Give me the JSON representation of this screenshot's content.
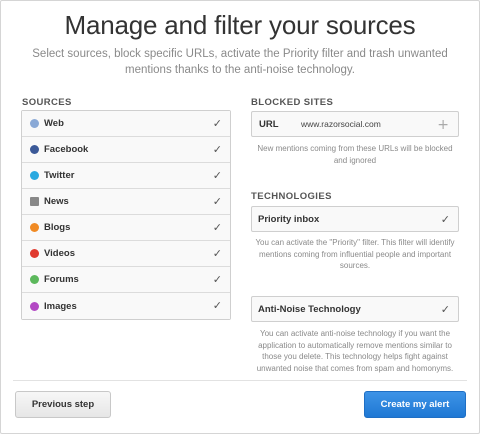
{
  "header": {
    "title": "Manage and filter your sources",
    "subtitle": "Select sources, block specific URLs, activate the Priority filter and trash unwanted mentions thanks to the anti-noise technology."
  },
  "sources": {
    "label": "SOURCES",
    "items": [
      {
        "label": "Web",
        "icon": "globe-icon",
        "color": "#8aa9d6",
        "checked": true
      },
      {
        "label": "Facebook",
        "icon": "facebook-icon",
        "color": "#3b5998",
        "checked": true
      },
      {
        "label": "Twitter",
        "icon": "twitter-icon",
        "color": "#2aa9e0",
        "checked": true
      },
      {
        "label": "News",
        "icon": "newspaper-icon",
        "color": "#888888",
        "checked": true
      },
      {
        "label": "Blogs",
        "icon": "blog-rss-icon",
        "color": "#f08a24",
        "checked": true
      },
      {
        "label": "Videos",
        "icon": "video-play-icon",
        "color": "#e03a2f",
        "checked": true
      },
      {
        "label": "Forums",
        "icon": "forum-chat-icon",
        "color": "#5cb85c",
        "checked": true
      },
      {
        "label": "Images",
        "icon": "camera-icon",
        "color": "#b349c4",
        "checked": true
      }
    ]
  },
  "blocked_sites": {
    "label": "BLOCKED SITES",
    "url_label": "URL",
    "url_value": "www.razorsocial.com",
    "helper": "New mentions coming from these URLs will be blocked and ignored"
  },
  "technologies": {
    "label": "TECHNOLOGIES",
    "priority": {
      "label": "Priority inbox",
      "checked": true,
      "helper": "You can activate the \"Priority\" filter. This filter will identify mentions coming from influential people and important sources."
    },
    "anti_noise": {
      "label": "Anti-Noise Technology",
      "checked": true,
      "helper": "You can activate anti-noise technology if you want the application to automatically remove mentions similar to those you delete. This technology helps fight against unwanted noise that comes from spam and homonyms."
    }
  },
  "footer": {
    "prev_label": "Previous step",
    "create_label": "Create my alert"
  },
  "colors": {
    "primary": "#1f78d4",
    "check": "#555555"
  }
}
